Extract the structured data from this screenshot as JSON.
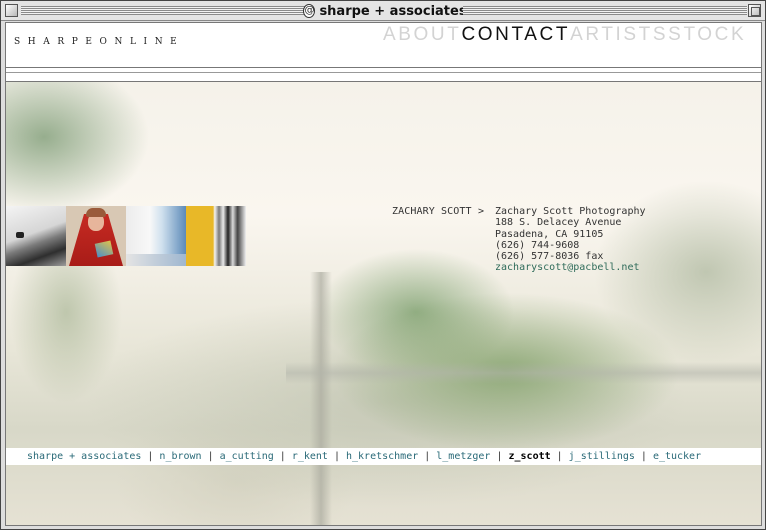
{
  "window": {
    "title": "sharpe + associates",
    "title_icon": "@"
  },
  "header": {
    "logo": "SHARPEONLINE",
    "nav": [
      {
        "label": "ABOUT",
        "active": false
      },
      {
        "label": "CONTACT",
        "active": true
      },
      {
        "label": "ARTISTS",
        "active": false
      },
      {
        "label": "STOCK",
        "active": false
      }
    ]
  },
  "contact": {
    "name": "ZACHARY SCOTT",
    "arrow": ">",
    "company": "Zachary Scott Photography",
    "address1": "188 S. Delacey Avenue",
    "address2": "Pasadena, CA 91105",
    "phone": "(626) 744-9608",
    "fax": "(626) 577-8036 fax",
    "email": "zacharyscott@pacbell.net"
  },
  "artist_nav": {
    "separator": "|",
    "items": [
      {
        "label": "sharpe + associates",
        "current": false
      },
      {
        "label": "n_brown",
        "current": false
      },
      {
        "label": "a_cutting",
        "current": false
      },
      {
        "label": "r_kent",
        "current": false
      },
      {
        "label": "h_kretschmer",
        "current": false
      },
      {
        "label": "l_metzger",
        "current": false
      },
      {
        "label": "z_scott",
        "current": true
      },
      {
        "label": "j_stillings",
        "current": false
      },
      {
        "label": "e_tucker",
        "current": false
      }
    ]
  },
  "colors": {
    "nav_inactive": "#d3d3d3",
    "nav_active": "#111111",
    "link": "#2a6a78",
    "email": "#2f6b5a"
  }
}
